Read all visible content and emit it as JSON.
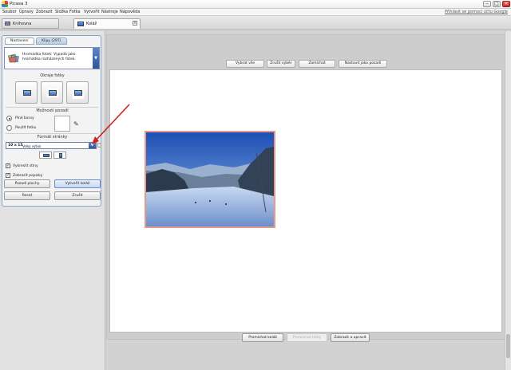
{
  "window": {
    "title": "Picasa 3"
  },
  "menu": {
    "items": [
      "Soubor",
      "Úpravy",
      "Zobrazit",
      "Složka",
      "Fotka",
      "Vytvořit",
      "Nástroje",
      "Nápověda"
    ],
    "signin": "Přihlásit se pomocí účtu Google"
  },
  "tabs": {
    "library": "Knihovna",
    "collage": "Koláž"
  },
  "panel": {
    "tab_settings": "Nastavení",
    "tab_clips": "Klipy (297)",
    "collage_type": "Hromádka fotek: Vypadá jako hromádka rozházených fotek.",
    "edges_title": "Okraje fotky",
    "bg_title": "Možnosti pozadí",
    "solid_color": "Plné barvy",
    "use_image": "Použít fotku",
    "format_title": "Formát stránky",
    "format_value": "10 x 15",
    "format_sub": "Velký výtisk",
    "check_shadows": "Vykreslit stíny",
    "check_captions": "Zobrazit popisky"
  },
  "buttons": {
    "desktop_bg": "Pozadí plochy",
    "create_collage": "Vytvořit koláž",
    "reset": "Reset",
    "clear": "Zrušit",
    "select_all": "Vybrat vše",
    "clear_selection": "Zrušit výběr",
    "shuffle": "Zamíchat",
    "set_background": "Nastavit jako pozadí",
    "shuffle_collage": "Promíchat koláž",
    "disabled_btn": "Promíchat fotky",
    "zoom_edit": "Zobrazit a upravit"
  },
  "colors": {
    "accent": "#2c549a",
    "photo_border": "#e69a8e",
    "arrow": "#d32020"
  }
}
